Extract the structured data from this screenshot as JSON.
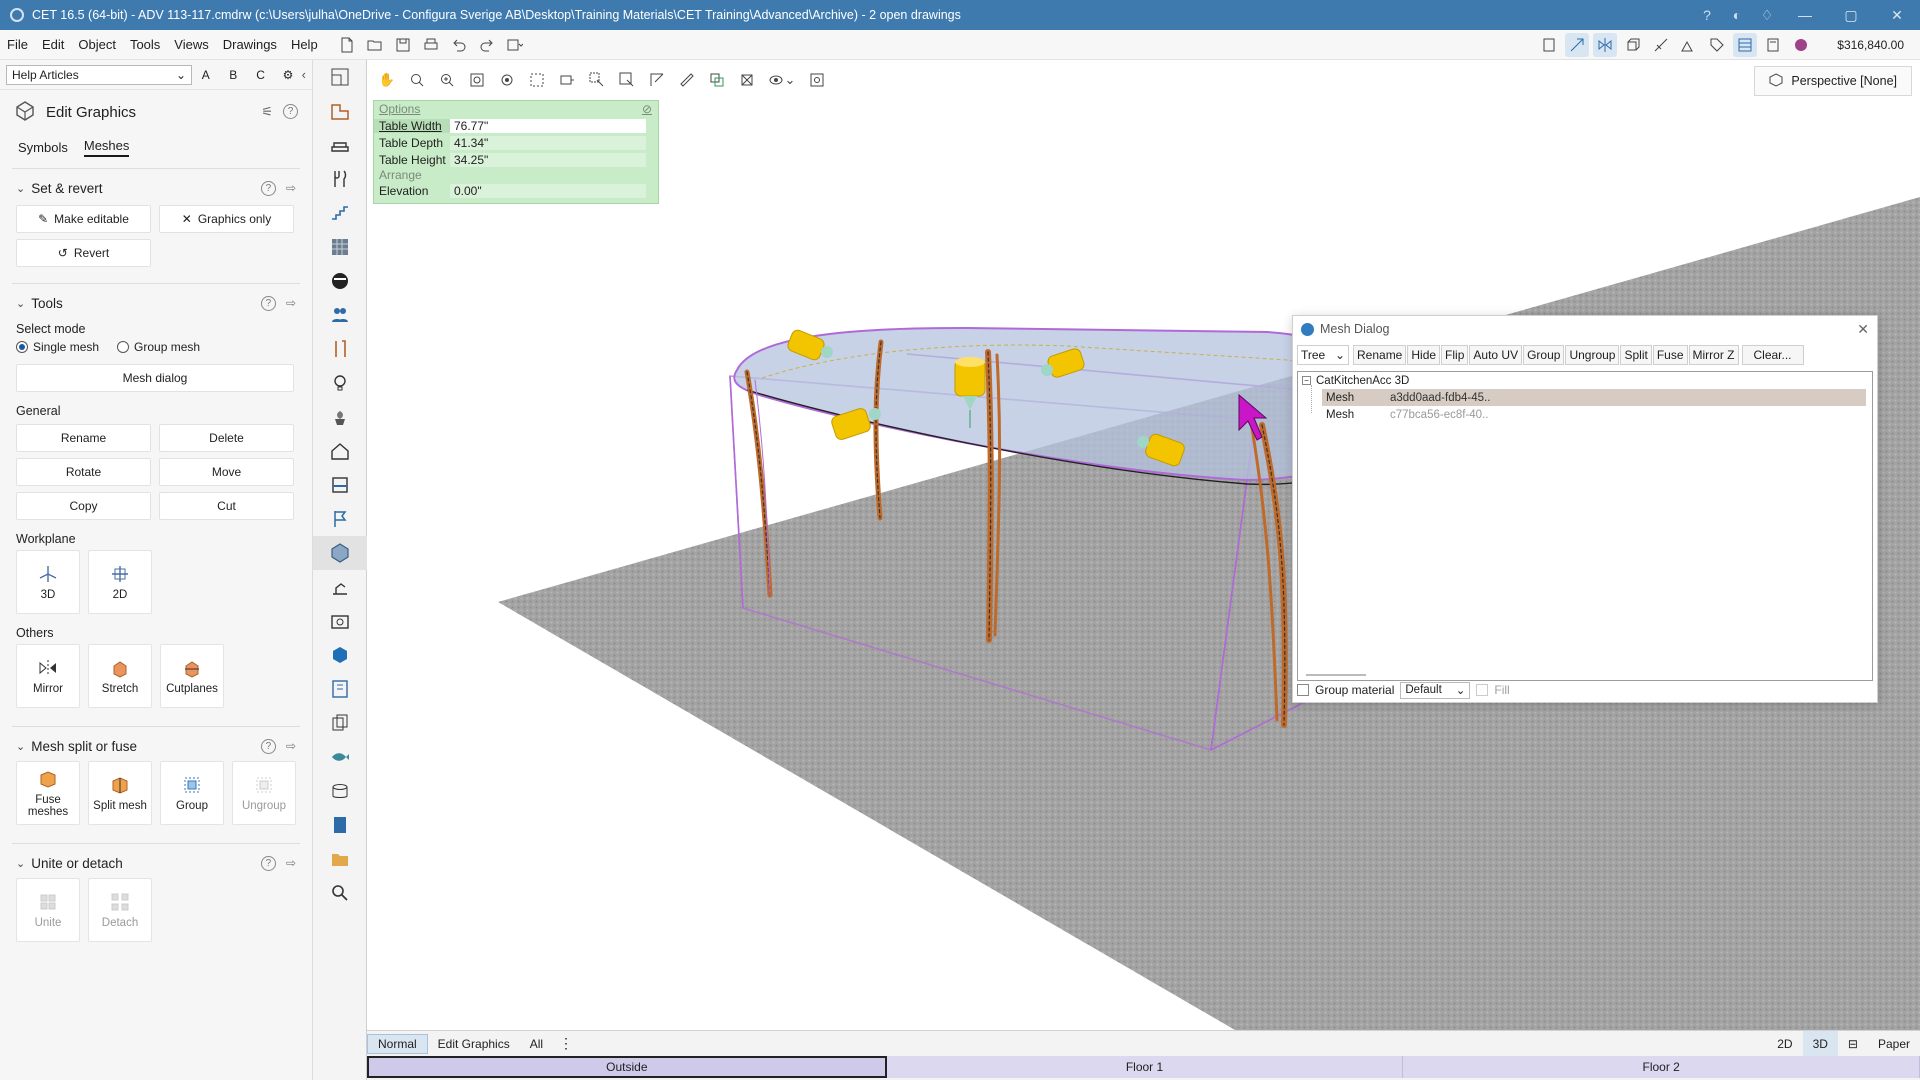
{
  "titlebar": {
    "title": "CET 16.5 (64-bit) - ADV 113-117.cmdrw (c:\\Users\\julha\\OneDrive - Configura Sverige AB\\Desktop\\Training Materials\\CET Training\\Advanced\\Archive) - 2  open drawings"
  },
  "menubar": {
    "items": [
      "File",
      "Edit",
      "Object",
      "Tools",
      "Views",
      "Drawings",
      "Help"
    ],
    "price": "$316,840.00"
  },
  "help": {
    "selected": "Help Articles",
    "letters": [
      "A",
      "B",
      "C"
    ]
  },
  "panel": {
    "title": "Edit Graphics",
    "tabs": [
      "Symbols",
      "Meshes"
    ],
    "set_revert": {
      "title": "Set & revert",
      "make_editable": "Make editable",
      "graphics_only": "Graphics only",
      "revert": "Revert"
    },
    "tools": {
      "title": "Tools",
      "select_mode_label": "Select mode",
      "single_mesh": "Single mesh",
      "group_mesh": "Group mesh",
      "mesh_dialog": "Mesh dialog",
      "general_label": "General",
      "rename": "Rename",
      "delete": "Delete",
      "rotate": "Rotate",
      "move": "Move",
      "copy": "Copy",
      "cut": "Cut",
      "workplane_label": "Workplane",
      "wp_3d": "3D",
      "wp_2d": "2D",
      "others_label": "Others",
      "mirror": "Mirror",
      "stretch": "Stretch",
      "cutplanes": "Cutplanes"
    },
    "split_fuse": {
      "title": "Mesh split or fuse",
      "fuse": "Fuse meshes",
      "split": "Split mesh",
      "group": "Group",
      "ungroup": "Ungroup"
    },
    "unite_detach": {
      "title": "Unite or detach",
      "unite": "Unite",
      "detach": "Detach"
    }
  },
  "viewport": {
    "perspective": "Perspective [None]",
    "options": {
      "header": "Options",
      "rows": [
        {
          "key": "Table Width",
          "value": "76.77\""
        },
        {
          "key": "Table Depth",
          "value": "41.34\""
        },
        {
          "key": "Table Height",
          "value": "34.25\""
        }
      ],
      "group_label": "Arrange",
      "elevation_key": "Elevation",
      "elevation_value": "0.00\""
    }
  },
  "mesh_dialog": {
    "title": "Mesh Dialog",
    "view_select": "Tree",
    "buttons": [
      "Rename",
      "Hide",
      "Flip",
      "Auto UV",
      "Group",
      "Ungroup",
      "Split",
      "Fuse",
      "Mirror Z"
    ],
    "clear": "Clear...",
    "root": "CatKitchenAcc 3D",
    "items": [
      {
        "name": "Mesh",
        "id": "a3dd0aad-fdb4-45.."
      },
      {
        "name": "Mesh",
        "id": "c77bca56-ec8f-40.."
      }
    ],
    "group_material_label": "Group material",
    "material_select": "Default",
    "fill_label": "Fill"
  },
  "bottom": {
    "tabs": [
      "Normal",
      "Edit Graphics",
      "All"
    ],
    "modes": [
      "2D",
      "3D",
      "Paper"
    ],
    "floors": [
      "Outside",
      "Floor 1",
      "Floor 2"
    ]
  },
  "colors": {
    "titlebar": "#3f7aae",
    "options_bg": "#c8ebc8",
    "selection_outline": "#b06ad8",
    "table_top": "#b4c3dd",
    "handles": "#f2c500",
    "floor": "#9a9a9a",
    "floor_tab": "#dcd8ef"
  }
}
